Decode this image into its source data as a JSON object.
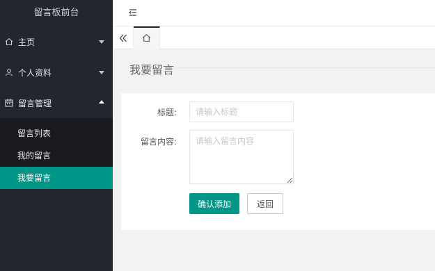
{
  "sidebar": {
    "logo": "留言板前台",
    "items": [
      {
        "label": "主页",
        "icon": "home-icon",
        "expanded": false
      },
      {
        "label": "个人资料",
        "icon": "user-icon",
        "expanded": false
      },
      {
        "label": "留言管理",
        "icon": "calendar-icon",
        "expanded": true
      }
    ],
    "subitems": [
      {
        "label": "留言列表"
      },
      {
        "label": "我的留言"
      },
      {
        "label": "我要留言",
        "active": true
      }
    ]
  },
  "header": {
    "toggle_icon": "menu-fold-icon"
  },
  "tabs": {
    "left_icon": "double-chevron-left-icon",
    "home_icon": "home-icon"
  },
  "page": {
    "heading": "我要留言"
  },
  "form": {
    "title_label": "标题:",
    "title_placeholder": "请输入标题",
    "content_label": "留言内容:",
    "content_placeholder": "请输入留言内容",
    "submit_label": "确认添加",
    "back_label": "返回"
  },
  "colors": {
    "accent": "#009688",
    "sidebar_bg": "#23262e",
    "subnav_bg": "#191b20"
  }
}
